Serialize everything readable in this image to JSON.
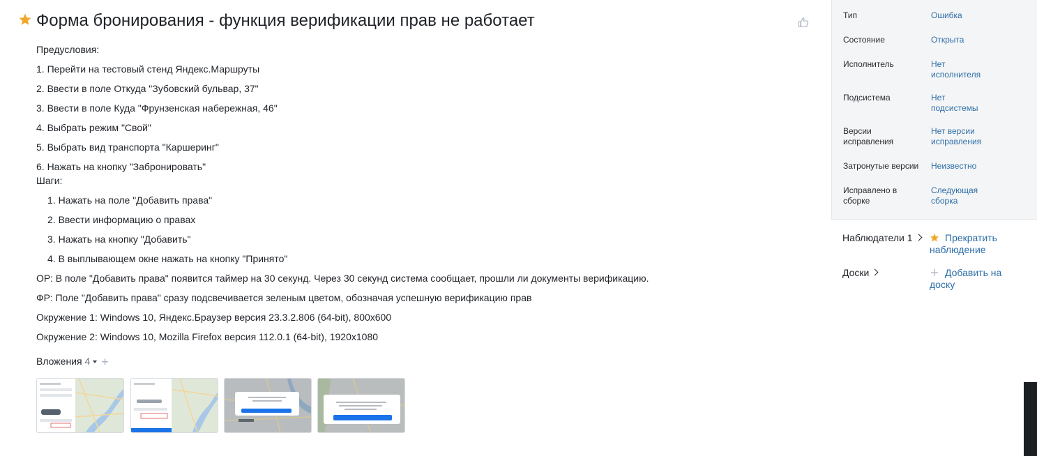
{
  "top_meta": {
    "text": "",
    "link": ""
  },
  "issue": {
    "title": "Форма бронирования - функция верификации прав не работает",
    "description": {
      "preconditions_header": "Предусловия:",
      "preconditions": [
        "1. Перейти на тестовый стенд Яндекс.Маршруты",
        "2. Ввести в поле Откуда \"Зубовский бульвар, 37\"",
        "3. Ввести в поле Куда \"Фрунзенская набережная, 46\"",
        "4. Выбрать режим \"Свой\"",
        "5. Выбрать вид транспорта \"Каршеринг\"",
        "6. Нажать на кнопку \"Забронировать\""
      ],
      "steps_header": "Шаги:",
      "steps": [
        "1. Нажать на поле \"Добавить права\"",
        "2. Ввести информацию о правах",
        "3. Нажать на кнопку \"Добавить\"",
        "4. В выплывающем окне нажать на кнопку \"Принято\""
      ],
      "expected": "ОР: В поле \"Добавить права\" появится таймер на 30 секунд. Через 30 секунд система сообщает, прошли ли документы верификацию.",
      "actual": "ФР: Поле \"Добавить права\" сразу подсвечивается зеленым цветом, обозначая успешную верификацию прав",
      "env1": "Окружение 1: Windows 10, Яндекс.Браузер версия 23.3.2.806 (64-bit), 800x600",
      "env2": "Окружение 2: Windows 10, Mozilla Firefox версия 112.0.1 (64-bit), 1920x1080"
    },
    "attachments": {
      "label": "Вложения",
      "count": "4",
      "items": [
        {
          "kind": "screenshot-form"
        },
        {
          "kind": "screenshot-form-highlight"
        },
        {
          "kind": "screenshot-dialog"
        },
        {
          "kind": "screenshot-dialog-accepted"
        }
      ]
    }
  },
  "fields": [
    {
      "label": "Тип",
      "value": "Ошибка"
    },
    {
      "label": "Состояние",
      "value": "Открыта"
    },
    {
      "label": "Исполнитель",
      "value": "Нет исполнителя"
    },
    {
      "label": "Подсистема",
      "value": "Нет подсистемы"
    },
    {
      "label": "Версии исправления",
      "value": "Нет версии исправления"
    },
    {
      "label": "Затронутые версии",
      "value": "Неизвестно"
    },
    {
      "label": "Исправлено в сборке",
      "value": "Следующая сборка"
    }
  ],
  "watchers": {
    "label": "Наблюдатели",
    "count": "1",
    "action": "Прекратить наблюдение"
  },
  "boards": {
    "label": "Доски",
    "action": "Добавить на доску"
  },
  "colors": {
    "link": "#2d6ea8",
    "star": "#f0a92e",
    "panel": "#f4f5f6",
    "map_green": "#d6e8c8",
    "map_water": "#a9c8e8",
    "button_blue": "#1a73e8"
  },
  "icons": [
    "star-icon",
    "thumbs-up-icon",
    "caret-down-icon",
    "plus-icon",
    "chevron-right-icon"
  ]
}
